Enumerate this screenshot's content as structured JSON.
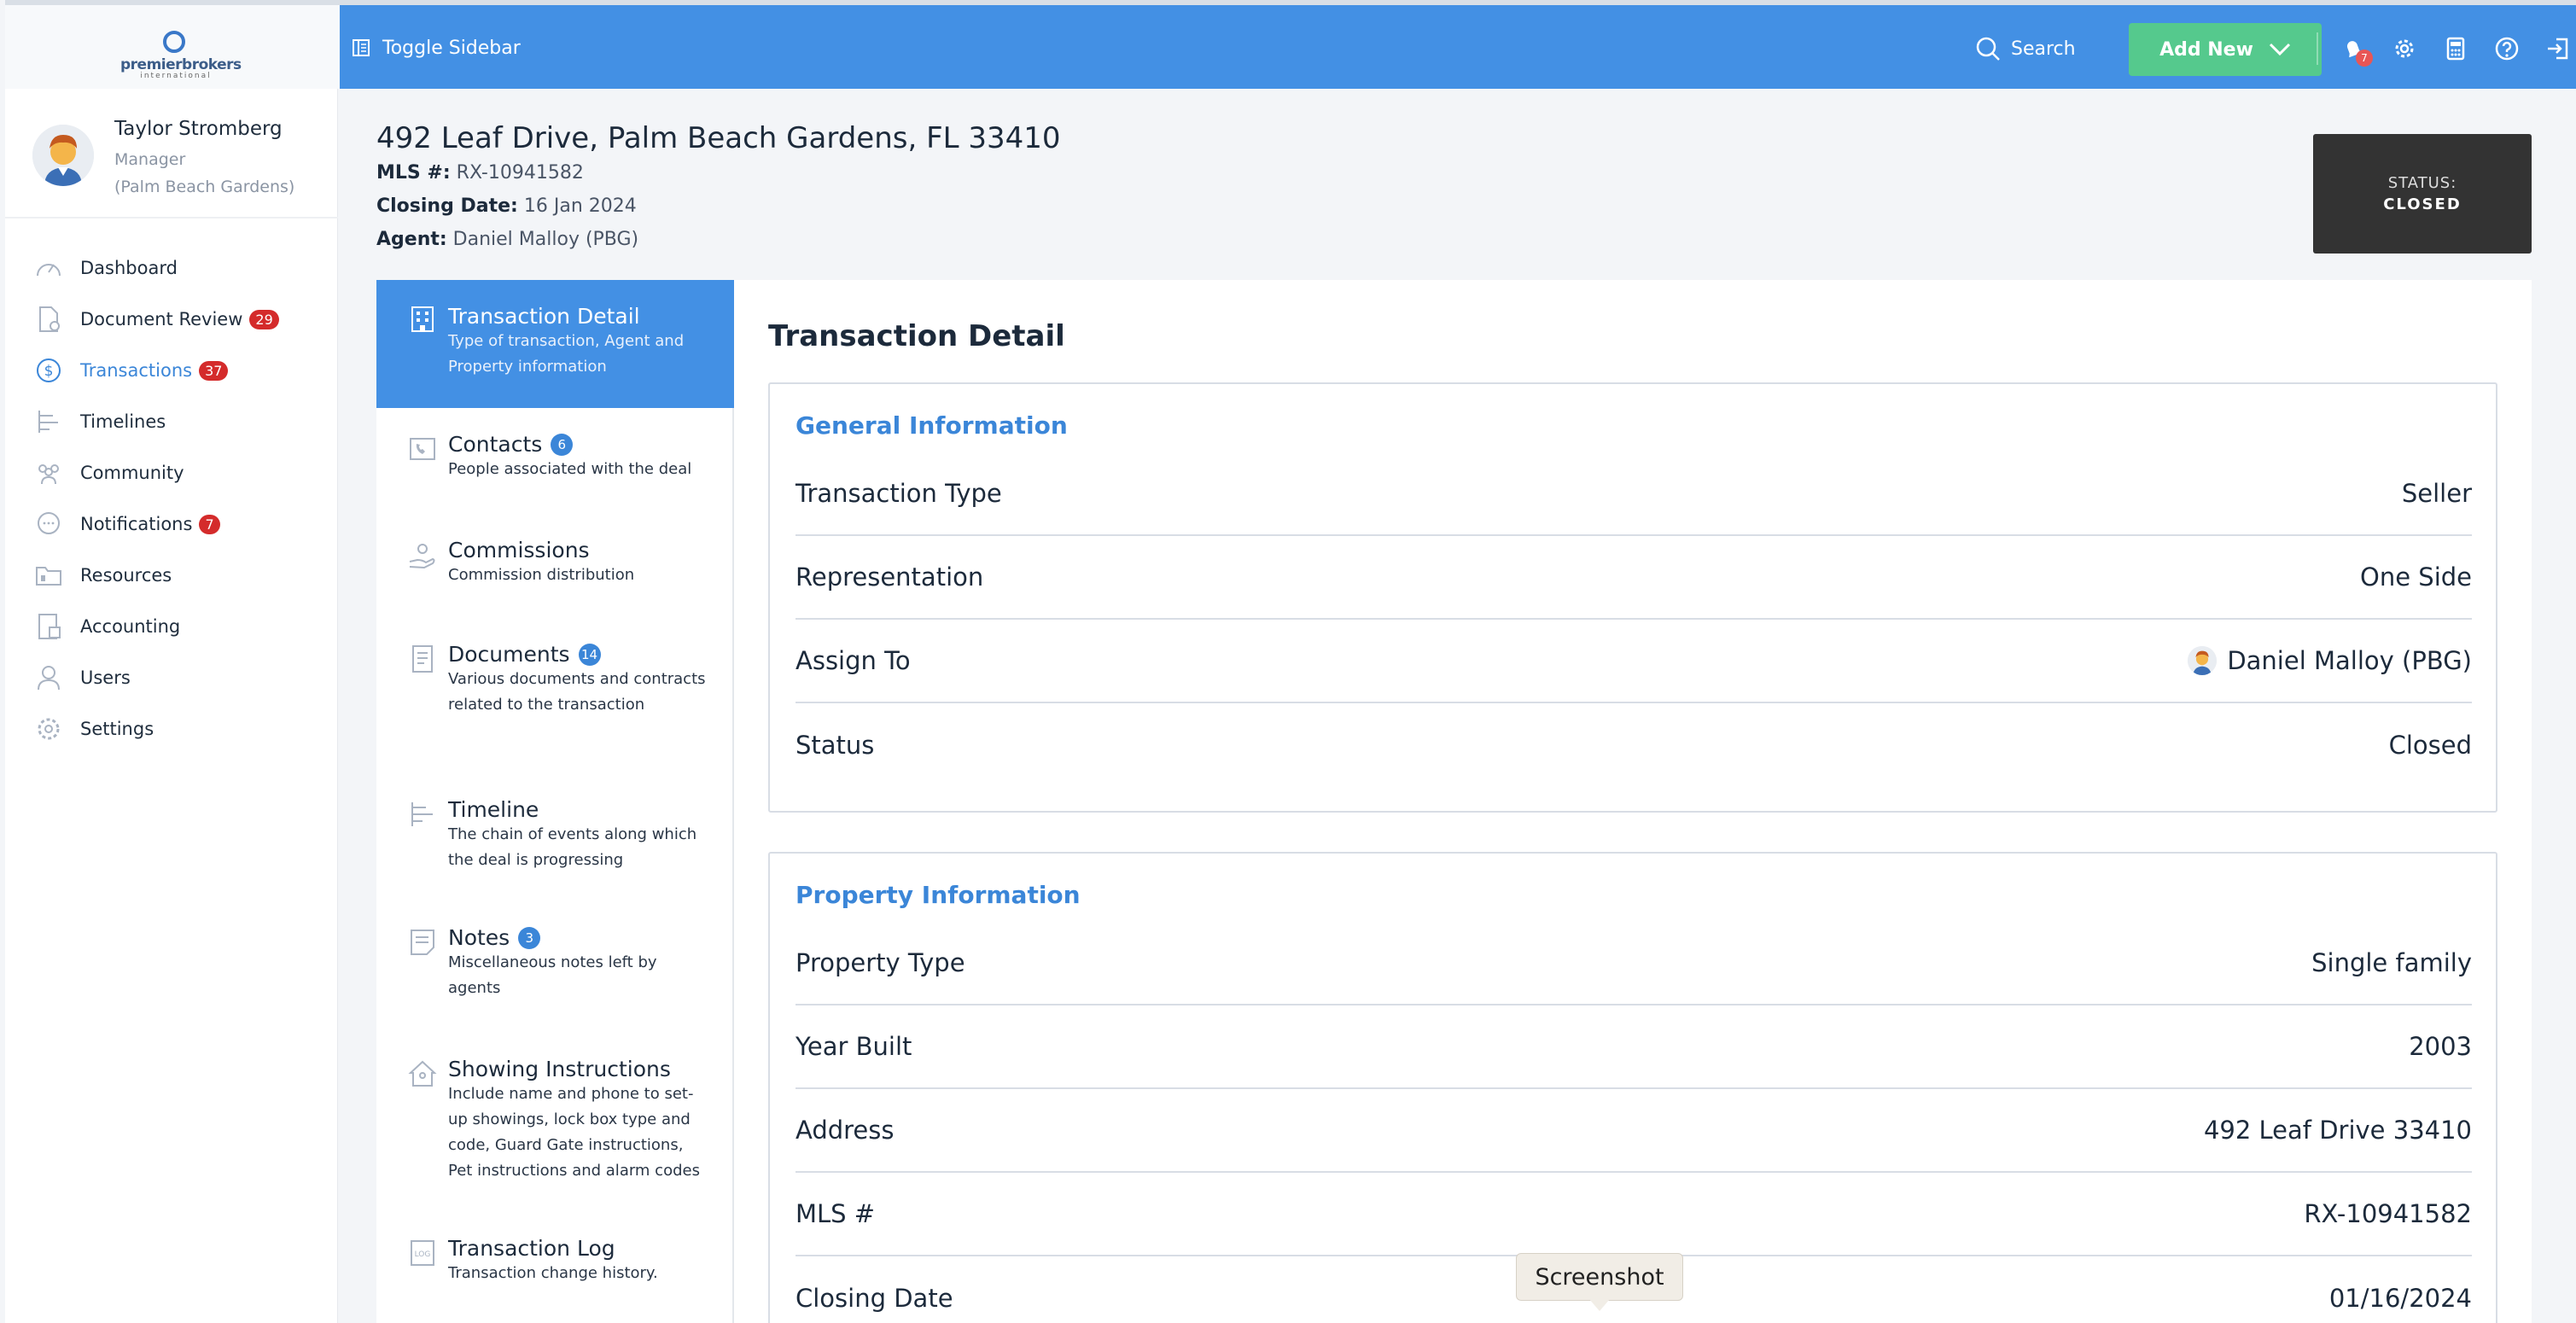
{
  "app": {
    "logo_text": "premierbrokers",
    "logo_sub": "international",
    "toggle_sidebar_label": "Toggle Sidebar",
    "search_label": "Search",
    "add_new_label": "Add New",
    "notification_count": "7",
    "accent_color": "#4390e4"
  },
  "profile": {
    "name": "Taylor Stromberg",
    "role": "Manager",
    "branch": "(Palm Beach Gardens)"
  },
  "sidebar": {
    "items": [
      {
        "label": "Dashboard",
        "icon": "speedometer-icon"
      },
      {
        "label": "Document Review",
        "icon": "document-check-icon",
        "badge": "29"
      },
      {
        "label": "Transactions",
        "icon": "dollar-circle-icon",
        "badge": "37",
        "active": true
      },
      {
        "label": "Timelines",
        "icon": "timeline-icon"
      },
      {
        "label": "Community",
        "icon": "people-icon"
      },
      {
        "label": "Notifications",
        "icon": "chat-bubble-icon",
        "badge": "7"
      },
      {
        "label": "Resources",
        "icon": "folder-icon"
      },
      {
        "label": "Accounting",
        "icon": "calculator-icon"
      },
      {
        "label": "Users",
        "icon": "user-icon"
      },
      {
        "label": "Settings",
        "icon": "gear-icon"
      }
    ]
  },
  "header": {
    "title": "492 Leaf Drive, Palm Beach Gardens, FL 33410",
    "mls_label": "MLS #:",
    "mls_value": "RX-10941582",
    "closing_label": "Closing Date:",
    "closing_value": "16 Jan 2024",
    "agent_label": "Agent:",
    "agent_value": "Daniel Malloy (PBG)",
    "status_label": "STATUS:",
    "status_value": "CLOSED"
  },
  "tabs": [
    {
      "title": "Transaction Detail",
      "desc": "Type of transaction, Agent and Property information",
      "active": true
    },
    {
      "title": "Contacts",
      "badge": "6",
      "desc": "People associated with the deal"
    },
    {
      "title": "Commissions",
      "desc": "Commission distribution"
    },
    {
      "title": "Documents",
      "badge": "14",
      "desc": "Various documents and contracts related to the transaction"
    },
    {
      "title": "Timeline",
      "desc": "The chain of events along which the deal is progressing"
    },
    {
      "title": "Notes",
      "badge": "3",
      "desc": "Miscellaneous notes left by agents"
    },
    {
      "title": "Showing Instructions",
      "desc": "Include name and phone to set-up showings, lock box type and code, Guard Gate instructions, Pet instructions and alarm codes"
    },
    {
      "title": "Transaction Log",
      "desc": "Transaction change history."
    }
  ],
  "content": {
    "title": "Transaction Detail",
    "general": {
      "title": "General Information",
      "rows": [
        {
          "label": "Transaction Type",
          "value": "Seller"
        },
        {
          "label": "Representation",
          "value": "One Side"
        },
        {
          "label": "Assign To",
          "value": "Daniel Malloy (PBG)"
        },
        {
          "label": "Status",
          "value": "Closed"
        }
      ]
    },
    "property": {
      "title": "Property Information",
      "rows": [
        {
          "label": "Property Type",
          "value": "Single family"
        },
        {
          "label": "Year Built",
          "value": "2003"
        },
        {
          "label": "Address",
          "value": "492 Leaf Drive 33410"
        },
        {
          "label": "MLS #",
          "value": "RX-10941582"
        },
        {
          "label": "Closing Date",
          "value": "01/16/2024"
        }
      ]
    }
  },
  "tooltip": {
    "label": "Screenshot"
  }
}
